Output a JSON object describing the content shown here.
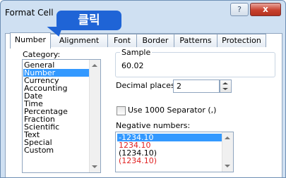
{
  "window": {
    "title": "Format Cell"
  },
  "title_buttons": {
    "help": "?",
    "close": "x"
  },
  "callout": {
    "text": "클릭"
  },
  "tabs": [
    {
      "label": "Number",
      "active": true
    },
    {
      "label": "Alignment",
      "active": false
    },
    {
      "label": "Font",
      "active": false
    },
    {
      "label": "Border",
      "active": false
    },
    {
      "label": "Patterns",
      "active": false
    },
    {
      "label": "Protection",
      "active": false
    }
  ],
  "category": {
    "label": "Category:",
    "items": [
      "General",
      "Number",
      "Currency",
      "Accounting",
      "Date",
      "Time",
      "Percentage",
      "Fraction",
      "Scientific",
      "Text",
      "Special",
      "Custom"
    ],
    "selected": "Number"
  },
  "sample": {
    "label": "Sample",
    "value": "60.02"
  },
  "decimal": {
    "label": "Decimal places:",
    "value": "2"
  },
  "separator": {
    "label": "Use 1000 Separator (,)",
    "checked": false
  },
  "negative": {
    "label": "Negative numbers:",
    "items": [
      {
        "text": "-1234.10",
        "color": "#ffffff",
        "selected": true
      },
      {
        "text": "1234.10",
        "color": "#e02020",
        "selected": false
      },
      {
        "text": "(1234.10)",
        "color": "#000000",
        "selected": false
      },
      {
        "text": "(1234.10)",
        "color": "#e02020",
        "selected": false
      }
    ]
  },
  "colors": {
    "accent": "#1f64d6",
    "selection": "#3399ff",
    "negative_red": "#e02020"
  }
}
